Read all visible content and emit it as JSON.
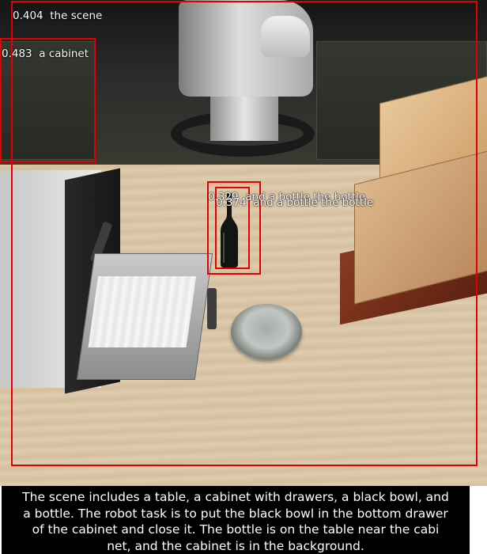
{
  "detections": [
    {
      "score": "0.404",
      "label": "the scene"
    },
    {
      "score": "0.483",
      "label": "a cabinet"
    },
    {
      "score": "0.329",
      "label": "and a bottle the bottle"
    },
    {
      "score": "0.374",
      "label": "and a bottle the bottle"
    }
  ],
  "caption": {
    "line1": "The scene includes a table, a cabinet with drawers, a black bowl, and",
    "line2": "a bottle. The robot task is to put the black bowl in the bottom drawer",
    "line3": "of the cabinet and close it. The bottle is on the table near the cabi",
    "line4": "net, and the cabinet is in the background."
  },
  "colors": {
    "box": "#e30000",
    "caption_bg": "#000000",
    "label_text": "#ffffff"
  }
}
